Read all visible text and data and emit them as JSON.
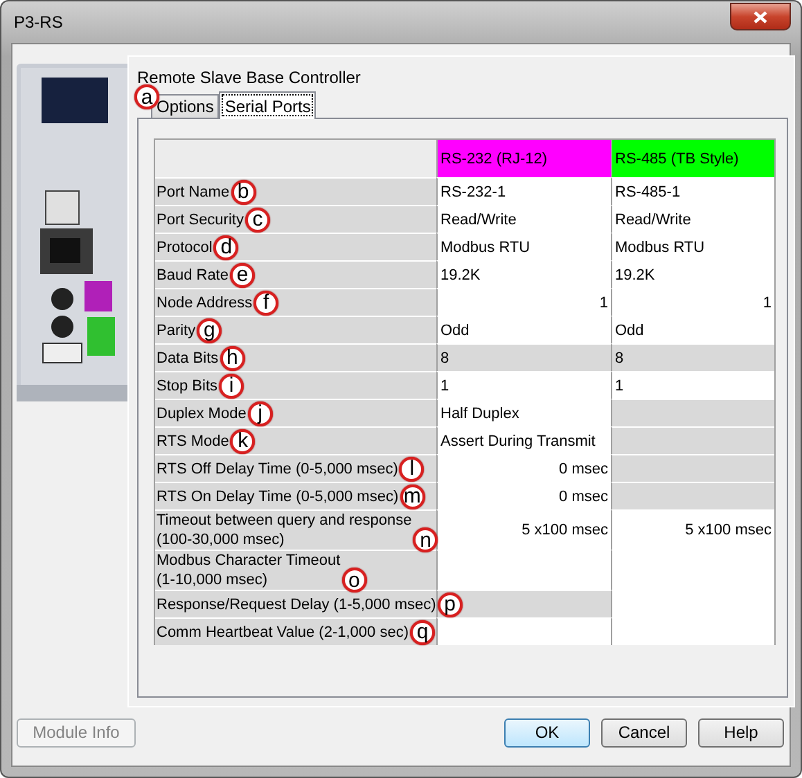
{
  "window": {
    "title": "P3-RS"
  },
  "heading": "Remote Slave Base Controller",
  "tabs_callout": "a",
  "tabs": [
    {
      "label": "Options",
      "selected": false
    },
    {
      "label": "Serial Ports",
      "selected": true
    }
  ],
  "grid": {
    "columns": [
      {
        "label": "RS-232 (RJ-12)",
        "color": "#ff00ff"
      },
      {
        "label": "RS-485 (TB Style)",
        "color": "#00ff00"
      }
    ],
    "rows": [
      {
        "label": "Port Name",
        "callout": "b",
        "cells": [
          {
            "kind": "text",
            "text": "RS-232-1",
            "disabled": false
          },
          {
            "kind": "text",
            "text": "RS-485-1",
            "disabled": false
          }
        ]
      },
      {
        "label": "Port Security",
        "callout": "c",
        "cells": [
          {
            "kind": "text",
            "text": "Read/Write",
            "disabled": false
          },
          {
            "kind": "text",
            "text": "Read/Write",
            "disabled": false
          }
        ]
      },
      {
        "label": "Protocol",
        "callout": "d",
        "cells": [
          {
            "kind": "text",
            "text": "Modbus RTU",
            "disabled": false
          },
          {
            "kind": "text",
            "text": "Modbus RTU",
            "disabled": false
          }
        ]
      },
      {
        "label": "Baud Rate",
        "callout": "e",
        "cells": [
          {
            "kind": "text",
            "text": "19.2K",
            "disabled": false
          },
          {
            "kind": "text",
            "text": "19.2K",
            "disabled": false
          }
        ]
      },
      {
        "label": "Node Address",
        "callout": "f",
        "cells": [
          {
            "kind": "number",
            "text": "1",
            "disabled": false
          },
          {
            "kind": "number",
            "text": "1",
            "disabled": false
          }
        ]
      },
      {
        "label": "Parity",
        "callout": "g",
        "cells": [
          {
            "kind": "text",
            "text": "Odd",
            "disabled": false
          },
          {
            "kind": "text",
            "text": "Odd",
            "disabled": false
          }
        ]
      },
      {
        "label": "Data Bits",
        "callout": "h",
        "cells": [
          {
            "kind": "text",
            "text": "8",
            "disabled": true
          },
          {
            "kind": "text",
            "text": "8",
            "disabled": true
          }
        ]
      },
      {
        "label": "Stop Bits",
        "callout": "i",
        "cells": [
          {
            "kind": "text",
            "text": "1",
            "disabled": false
          },
          {
            "kind": "text",
            "text": "1",
            "disabled": false
          }
        ]
      },
      {
        "label": "Duplex Mode",
        "callout": "j",
        "cells": [
          {
            "kind": "text",
            "text": "Half Duplex",
            "disabled": false
          },
          {
            "kind": "text",
            "disabled": true
          }
        ]
      },
      {
        "label": "RTS Mode",
        "callout": "k",
        "cells": [
          {
            "kind": "text",
            "text": "Assert During Transmit",
            "disabled": false
          },
          {
            "kind": "text",
            "disabled": true
          }
        ]
      },
      {
        "label": "RTS Off Delay Time (0-5,000 msec)",
        "callout": "l",
        "cells": [
          {
            "kind": "number",
            "text": "0  msec",
            "disabled": false
          },
          {
            "kind": "text",
            "disabled": true
          }
        ]
      },
      {
        "label": "RTS On Delay Time (0-5,000 msec)",
        "callout": "m",
        "cells": [
          {
            "kind": "number",
            "text": "0  msec",
            "disabled": false
          },
          {
            "kind": "text",
            "disabled": true
          }
        ]
      },
      {
        "label": "Timeout between query and response\n(100-30,000 msec)",
        "callout": "n",
        "cells": [
          {
            "kind": "number",
            "text": "5  x100 msec",
            "disabled": false
          },
          {
            "kind": "number",
            "text": "5  x100 msec",
            "disabled": false
          }
        ]
      },
      {
        "label": "Modbus Character Timeout\n(1-10,000 msec)",
        "callout": "o",
        "cells": [
          {
            "kind": "text",
            "disabled": false
          },
          {
            "kind": "text",
            "disabled": false
          }
        ]
      },
      {
        "label": "Response/Request Delay (1-5,000 msec)",
        "callout": "p",
        "cells": [
          {
            "kind": "text",
            "disabled": true
          },
          {
            "kind": "text",
            "disabled": false
          }
        ]
      },
      {
        "label": "Comm Heartbeat Value (2-1,000 sec)",
        "callout": "q",
        "cells": [
          {
            "kind": "text",
            "disabled": false
          },
          {
            "kind": "text",
            "disabled": false
          }
        ]
      }
    ]
  },
  "buttons": [
    {
      "label": "Module Info",
      "disabled": true,
      "default": false
    },
    {
      "label": "OK",
      "disabled": false,
      "default": true
    },
    {
      "label": "Cancel",
      "disabled": false,
      "default": false
    },
    {
      "label": "Help",
      "disabled": false,
      "default": false
    }
  ]
}
